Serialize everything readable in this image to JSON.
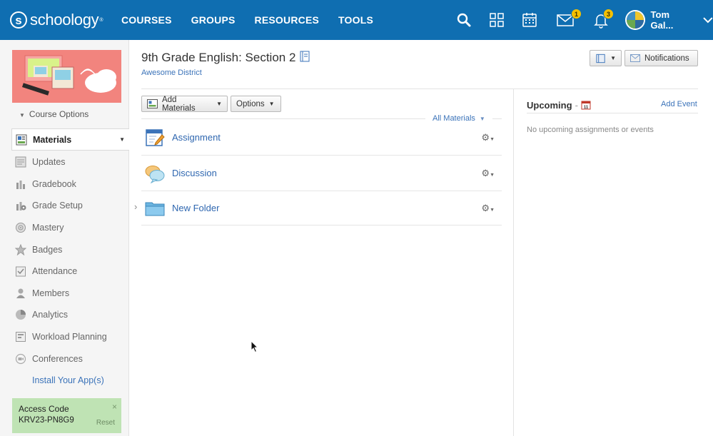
{
  "topbar": {
    "logo": "schoology",
    "logo_mark": "s",
    "logo_tm": "®",
    "nav": [
      "COURSES",
      "GROUPS",
      "RESOURCES",
      "TOOLS"
    ],
    "messages_count": "1",
    "notifications_count": "3",
    "user_name": "Tom Gal...",
    "bar_color": "#0f6eb1"
  },
  "sidebar": {
    "course_options": "Course Options",
    "items": [
      {
        "label": "Materials",
        "icon": "materials-icon"
      },
      {
        "label": "Updates",
        "icon": "updates-icon"
      },
      {
        "label": "Gradebook",
        "icon": "gradebook-icon"
      },
      {
        "label": "Grade Setup",
        "icon": "grade-setup-icon"
      },
      {
        "label": "Mastery",
        "icon": "mastery-icon"
      },
      {
        "label": "Badges",
        "icon": "badges-icon"
      },
      {
        "label": "Attendance",
        "icon": "attendance-icon"
      },
      {
        "label": "Members",
        "icon": "members-icon"
      },
      {
        "label": "Analytics",
        "icon": "analytics-icon"
      },
      {
        "label": "Workload Planning",
        "icon": "workload-planning-icon"
      },
      {
        "label": "Conferences",
        "icon": "conferences-icon"
      }
    ],
    "install_apps": "Install Your App(s)",
    "access_code": {
      "label": "Access Code",
      "code": "KRV23-PN8G9",
      "reset": "Reset",
      "close": "×"
    }
  },
  "main": {
    "course_title": "9th Grade English: Section 2",
    "district": "Awesome District",
    "add_materials": "Add Materials",
    "options": "Options",
    "notifications": "Notifications",
    "filter": "All Materials",
    "materials": [
      {
        "title": "Assignment",
        "icon": "assignment-icon"
      },
      {
        "title": "Discussion",
        "icon": "discussion-icon"
      },
      {
        "title": "New Folder",
        "icon": "folder-icon"
      }
    ]
  },
  "upcoming": {
    "title": "Upcoming",
    "separator": "-",
    "add_event": "Add Event",
    "empty": "No upcoming assignments or events",
    "calendar_day": "11"
  }
}
